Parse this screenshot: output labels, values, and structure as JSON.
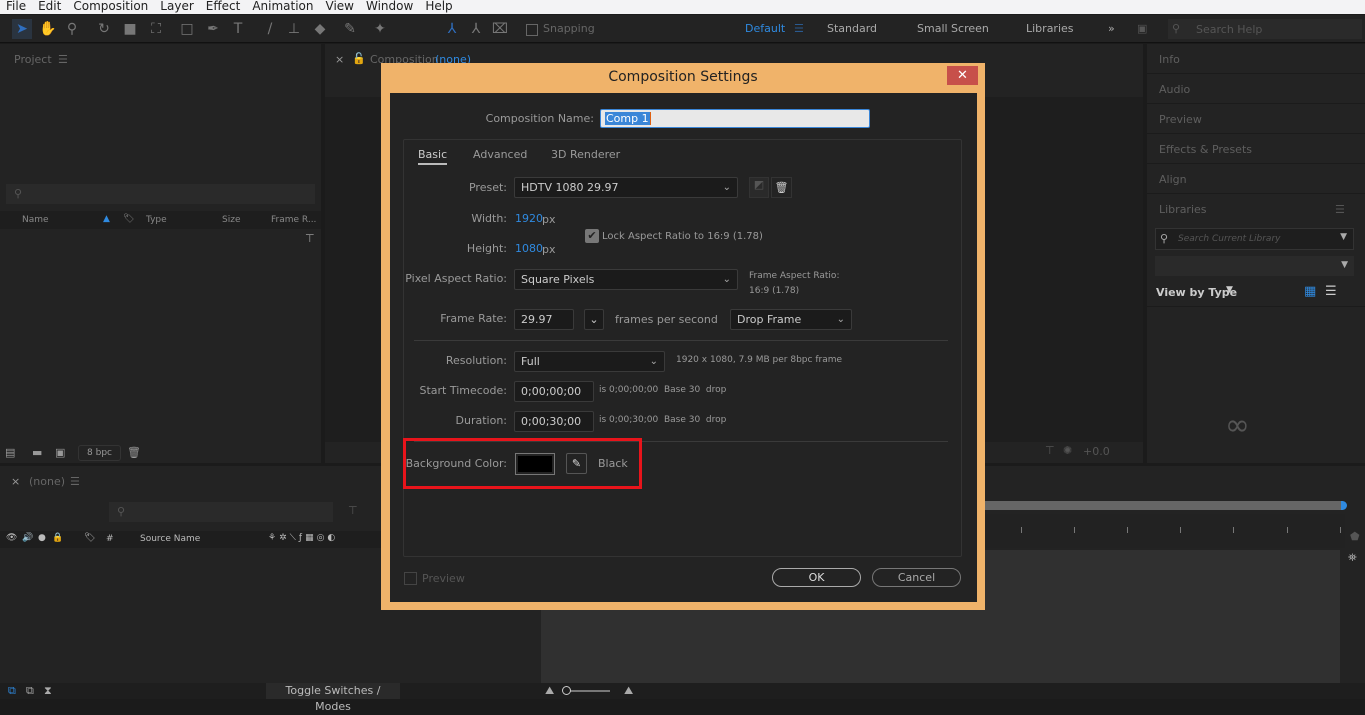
{
  "menu": [
    "File",
    "Edit",
    "Composition",
    "Layer",
    "Effect",
    "Animation",
    "View",
    "Window",
    "Help"
  ],
  "toolbar": {
    "snapping": "Snapping",
    "workspaces": [
      "Default",
      "Standard",
      "Small Screen",
      "Libraries"
    ],
    "search_placeholder": "Search Help"
  },
  "project": {
    "title": "Project",
    "columns": [
      "Name",
      "Type",
      "Size",
      "Frame R..."
    ],
    "bpc": "8 bpc"
  },
  "composition_panel": {
    "title": "Composition",
    "name": "(none)",
    "exposure": "+0.0"
  },
  "right_panel": {
    "items": [
      "Info",
      "Audio",
      "Preview",
      "Effects & Presets",
      "Align",
      "Libraries"
    ],
    "search_placeholder": "Search Current Library",
    "view_by": "View by Type"
  },
  "timeline": {
    "title": "(none)",
    "source_name": "Source Name",
    "hash": "#",
    "toggle": "Toggle Switches / Modes"
  },
  "dialog": {
    "title": "Composition Settings",
    "close": "✕",
    "comp_name_label": "Composition Name:",
    "comp_name": "Comp 1",
    "tabs": [
      "Basic",
      "Advanced",
      "3D Renderer"
    ],
    "preset_label": "Preset:",
    "preset": "HDTV 1080 29.97",
    "width_label": "Width:",
    "width": "1920",
    "height_label": "Height:",
    "height": "1080",
    "px": "px",
    "lock_aspect": "Lock Aspect Ratio to 16:9 (1.78)",
    "lock_checked": true,
    "par_label": "Pixel Aspect Ratio:",
    "par": "Square Pixels",
    "far_label": "Frame Aspect Ratio:",
    "far": "16:9 (1.78)",
    "fr_label": "Frame Rate:",
    "fr": "29.97",
    "fps": "frames per second",
    "drop": "Drop Frame",
    "res_label": "Resolution:",
    "res": "Full",
    "res_info": "1920 x 1080, 7.9 MB per 8bpc frame",
    "start_label": "Start Timecode:",
    "start": "0;00;00;00",
    "start_info": "is 0;00;00;00  Base 30  drop",
    "dur_label": "Duration:",
    "dur": "0;00;30;00",
    "dur_info": "is 0;00;30;00  Base 30  drop",
    "bg_label": "Background Color:",
    "bg_name": "Black",
    "bg_color": "#000000",
    "preview": "Preview",
    "ok": "OK",
    "cancel": "Cancel"
  }
}
